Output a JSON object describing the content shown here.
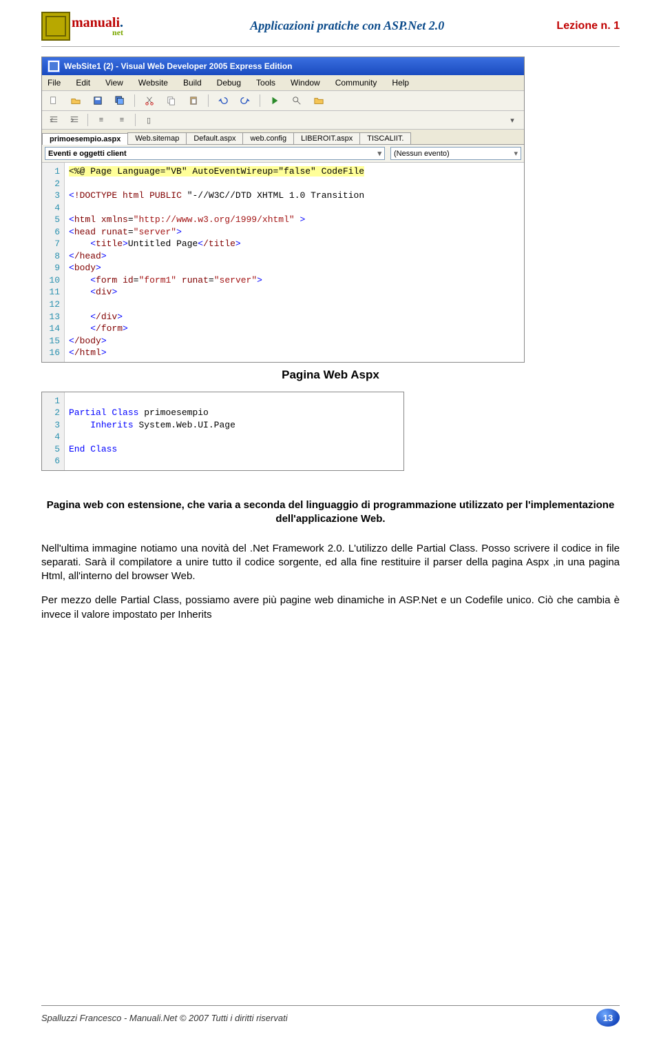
{
  "header": {
    "logo_a": "manuali",
    "logo_b": ".",
    "logo_c": "net",
    "title": "Applicazioni pratiche con ASP.Net 2.0",
    "lesson": "Lezione n. 1"
  },
  "ide": {
    "window_title": "WebSite1 (2) - Visual Web Developer 2005 Express Edition",
    "menu": [
      "File",
      "Edit",
      "View",
      "Website",
      "Build",
      "Debug",
      "Tools",
      "Window",
      "Community",
      "Help"
    ],
    "tabs": [
      "primoesempio.aspx",
      "Web.sitemap",
      "Default.aspx",
      "web.config",
      "LIBEROIT.aspx",
      "TISCALIIT."
    ],
    "active_tab": 0,
    "selector_left": "Eventi e oggetti client",
    "selector_right": "(Nessun evento)",
    "code_lines": [
      "<%@ Page Language=\"VB\" AutoEventWireup=\"false\" CodeFile",
      "",
      "<!DOCTYPE html PUBLIC \"-//W3C//DTD XHTML 1.0 Transition",
      "",
      "<html xmlns=\"http://www.w3.org/1999/xhtml\" >",
      "<head runat=\"server\">",
      "    <title>Untitled Page</title>",
      "</head>",
      "<body>",
      "    <form id=\"form1\" runat=\"server\">",
      "    <div>",
      "",
      "    </div>",
      "    </form>",
      "</body>",
      "</html>"
    ]
  },
  "caption": "Pagina Web Aspx",
  "ide2": {
    "code_lines": [
      "",
      "Partial Class primoesempio",
      "    Inherits System.Web.UI.Page",
      "",
      "End Class",
      ""
    ]
  },
  "para": {
    "lead1": "Pagina web con estensione, che varia a seconda del linguaggio di programmazione utilizzato per l'implementazione dell'applicazione Web.",
    "p1": "Nell'ultima immagine notiamo una novità del .Net Framework 2.0. L'utilizzo delle Partial Class. Posso scrivere il codice in file separati. Sarà il compilatore a unire tutto il codice sorgente, ed alla fine restituire il parser della pagina Aspx ,in una pagina Html, all'interno del browser Web.",
    "p2": "Per mezzo delle Partial Class, possiamo avere più pagine web dinamiche in ASP.Net e un Codefile unico. Ciò che cambia è invece il valore impostato per Inherits"
  },
  "footer": {
    "text": "Spalluzzi Francesco - Manuali.Net © 2007 Tutti i diritti riservati",
    "page": "13"
  }
}
